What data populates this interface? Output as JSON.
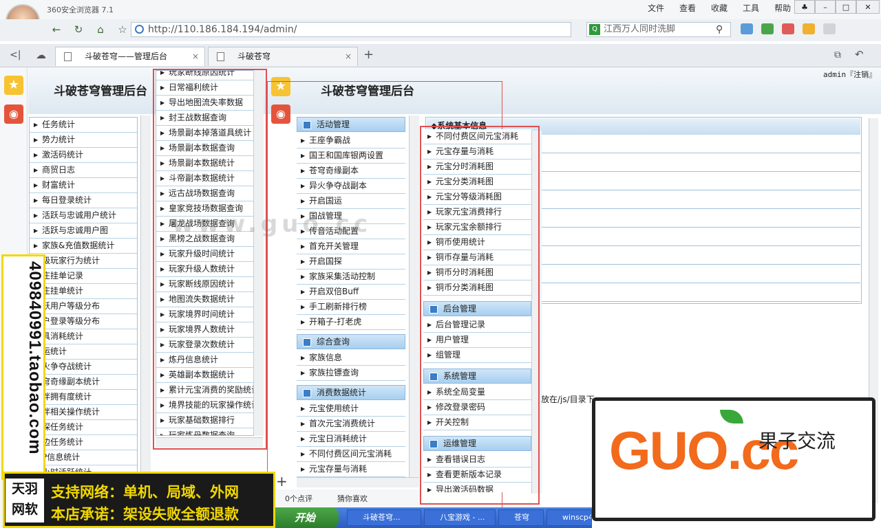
{
  "browser": {
    "app_title": "360安全浏览器 7.1",
    "menu": [
      "文件",
      "查看",
      "收藏",
      "工具",
      "帮助"
    ],
    "url": "http://110.186.184.194/admin/",
    "search_placeholder": "江西万人同时洗脚",
    "tabs": [
      {
        "label": "斗破苍穹——管理后台",
        "active": true
      },
      {
        "label": "斗破苍穹",
        "active": false
      }
    ]
  },
  "page": {
    "title_left": "斗破苍穹管理后台",
    "title_right": "斗破苍穹管理后台",
    "admin_text": "admin『注销』",
    "table_header": "◆系统基本信息",
    "note_text": "放在/js/目录下"
  },
  "menu_left": [
    "任务统计",
    "势力统计",
    "激活码统计",
    "商贸日志",
    "财富统计",
    "每日登录统计",
    "活跃与忠诚用户统计",
    "活跃与忠诚用户图",
    "家族&充值数据统计",
    "级玩家行为统计",
    "庄挂单记录",
    "庄挂单统计",
    "跃用户等级分布",
    "户登录等级分布",
    "具消耗统计",
    "运统计",
    "火争夺战统计",
    "穹奇缘副本统计",
    "伴拥有度统计",
    "伴相关操作统计",
    "探任务统计",
    "边任务统计",
    "P信息统计",
    "小时活跃统计"
  ],
  "menu_mid": [
    "玩家断线原因统计",
    "日常福利统计",
    "导出地图流失率数据",
    "封王战数据查询",
    "场景副本掉落道具统计",
    "场景副本数据查询",
    "场景副本数据统计",
    "斗帝副本数据统计",
    "远古战场数据查询",
    "皇家竞技场数据查询",
    "屠龙战场数据查询",
    "黑榜之战数据查询",
    "玩家升级时间统计",
    "玩家升级人数统计",
    "玩家断线原因统计",
    "地图流失数据统计",
    "玩家境界时间统计",
    "玩家境界人数统计",
    "玩家登录次数统计",
    "炼丹信息统计",
    "英雄副本数据统计",
    "累计元宝消费的奖励统计",
    "境界技能的玩家操作统计",
    "玩家基础数据排行",
    "玩家炼丹数据查询"
  ],
  "menu_c3": {
    "categories": [
      "活动管理",
      "综合查询",
      "消费数据统计"
    ],
    "activity_items": [
      "王座争霸战",
      "国王和国库银两设置",
      "苍穹奇缘副本",
      "异火争夺战副本",
      "开启国运",
      "国战管理",
      "传音活动配置",
      "首充开关管理",
      "开启国探",
      "家族采集活动控制",
      "开启双倍Buff",
      "手工刷新排行榜",
      "开箱子-打老虎"
    ],
    "query_items": [
      "家族信息",
      "家族拉镖查询"
    ],
    "consume_items": [
      "元宝使用统计",
      "首次元宝消费统计",
      "元宝日消耗统计",
      "不同付费区间元宝消耗",
      "元宝存量与消耗"
    ]
  },
  "menu_c4": {
    "top_items": [
      "不同付费区间元宝消耗",
      "元宝存量与消耗",
      "元宝分时消耗图",
      "元宝分类消耗图",
      "元宝分等级消耗图",
      "玩家元宝消费排行",
      "玩家元宝余额排行",
      "铜币使用统计",
      "铜币存量与消耗",
      "铜币分时消耗图",
      "铜币分类消耗图"
    ],
    "categories": [
      "后台管理",
      "系统管理",
      "运维管理"
    ],
    "backend_items": [
      "后台管理记录",
      "用户管理",
      "组管理"
    ],
    "system_items": [
      "系统全局变量",
      "修改登录密码",
      "开关控制"
    ],
    "ops_items": [
      "查看错误日志",
      "查看更新版本记录",
      "导出激活码数据"
    ]
  },
  "status": {
    "comments": "0个点评",
    "like": "猜你喜欢"
  },
  "taskbar": {
    "start": "开始",
    "items": [
      "斗破苍穹...",
      "八宝游戏 - ...",
      "苍穹",
      "winscp43..."
    ]
  },
  "promo": {
    "phone": "409840991.taobao.com",
    "logo": "天羽网软",
    "line1": "支持网络：单机、局域、外网",
    "line2": "本店承诺：架设失败全额退款"
  },
  "watermark": {
    "main": "GUO.cc",
    "sub": "果子交流",
    "faint": "www.guo.cc"
  }
}
